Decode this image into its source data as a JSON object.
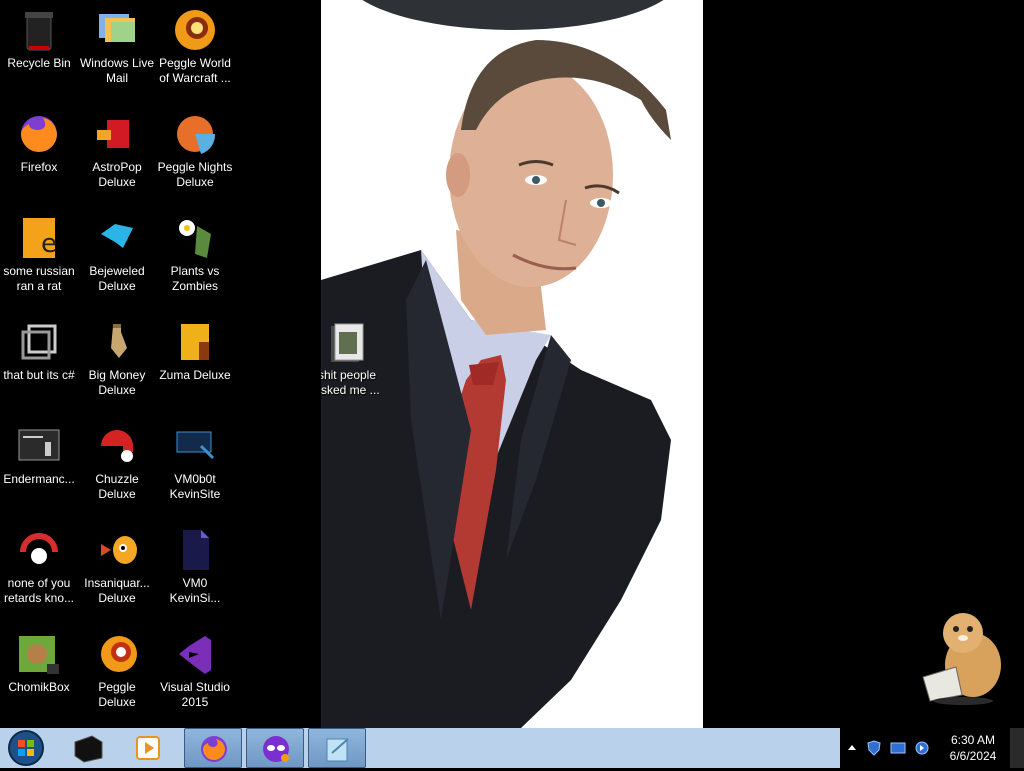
{
  "desktop": {
    "icons": [
      {
        "label": "Recycle Bin",
        "icon": "recycle-bin-icon"
      },
      {
        "label": "Windows Live\nMail",
        "icon": "windows-live-mail-icon"
      },
      {
        "label": "Peggle World\nof Warcraft ...",
        "icon": "peggle-wow-icon"
      },
      {
        "label": "Firefox",
        "icon": "firefox-icon"
      },
      {
        "label": "AstroPop\nDeluxe",
        "icon": "astropop-icon"
      },
      {
        "label": "Peggle Nights\nDeluxe",
        "icon": "peggle-nights-icon"
      },
      {
        "label": "some russian\nran a rat",
        "icon": "sandboxie-icon"
      },
      {
        "label": "Bejeweled\nDeluxe",
        "icon": "bejeweled-icon"
      },
      {
        "label": "Plants vs\nZombies",
        "icon": "plants-vs-zombies-icon"
      },
      {
        "label": "that but its c#",
        "icon": "shortcut-folder-icon"
      },
      {
        "label": "Big Money\nDeluxe",
        "icon": "big-money-icon"
      },
      {
        "label": "Zuma Deluxe",
        "icon": "zuma-icon"
      },
      {
        "label": "Endermanc...",
        "icon": "terminal-icon"
      },
      {
        "label": "Chuzzle\nDeluxe",
        "icon": "chuzzle-icon"
      },
      {
        "label": "VM0b0t\nKevinSite",
        "icon": "vm-monitor-icon"
      },
      {
        "label": "none of you\nretards kno...",
        "icon": "app-icon"
      },
      {
        "label": "Insaniquar...\nDeluxe",
        "icon": "insaniquarium-icon"
      },
      {
        "label": "VM0\nKevinSi...",
        "icon": "vm-file-icon"
      },
      {
        "label": "ChomikBox",
        "icon": "chomikbox-icon"
      },
      {
        "label": "Peggle Deluxe",
        "icon": "peggle-deluxe-icon"
      },
      {
        "label": "Visual Studio\n2015",
        "icon": "visual-studio-icon"
      }
    ],
    "wallpaper_folder": {
      "label": "shit people\nasked me ...",
      "icon": "folder-icon"
    }
  },
  "taskbar": {
    "start_icon": "windows-orb-icon",
    "pinned": [
      {
        "icon": "black-box-app-icon"
      },
      {
        "icon": "media-player-icon"
      }
    ],
    "running": [
      {
        "icon": "firefox-icon"
      },
      {
        "icon": "purple-mask-app-icon"
      },
      {
        "icon": "notepad-app-icon"
      }
    ],
    "tray": {
      "icons": [
        "show-hidden-icons-arrow",
        "shield-icon",
        "network-icon",
        "sound-icon"
      ],
      "time": "6:30 AM",
      "date": "6/6/2024"
    }
  }
}
